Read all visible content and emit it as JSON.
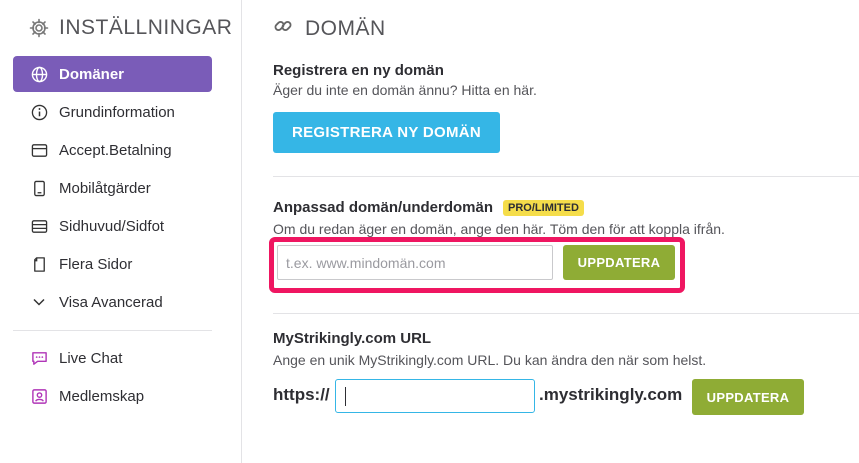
{
  "sidebar": {
    "title": "INSTÄLLNINGAR",
    "icon": "gear-icon",
    "items": [
      {
        "label": "Domäner",
        "icon": "globe-icon",
        "active": true
      },
      {
        "label": "Grundinformation",
        "icon": "info-icon"
      },
      {
        "label": "Accept.Betalning",
        "icon": "card-icon"
      },
      {
        "label": "Mobilåtgärder",
        "icon": "mobile-icon"
      },
      {
        "label": "Sidhuvud/Sidfot",
        "icon": "layout-icon"
      },
      {
        "label": "Flera Sidor",
        "icon": "pages-icon"
      },
      {
        "label": "Visa Avancerad",
        "icon": "chevron-down-icon"
      }
    ],
    "secondary_items": [
      {
        "label": "Live Chat",
        "icon": "chat-icon"
      },
      {
        "label": "Medlemskap",
        "icon": "member-icon"
      }
    ]
  },
  "main": {
    "title": "DOMÄN",
    "icon": "link-icon",
    "register": {
      "title": "Registrera en ny domän",
      "desc": "Äger du inte en domän ännu? Hitta en här.",
      "button": "REGISTRERA NY DOMÄN"
    },
    "custom": {
      "title": "Anpassad domän/underdomän",
      "badge": "PRO/LIMITED",
      "desc": "Om du redan äger en domän, ange den här. Töm den för att koppla ifrån.",
      "placeholder": "t.ex. www.mindomän.com",
      "button": "UPPDATERA"
    },
    "url": {
      "title": "MyStrikingly.com URL",
      "desc": "Ange en unik MyStrikingly.com URL. Du kan ändra den när som helst.",
      "prefix": "https://",
      "value": "",
      "suffix": ".mystrikingly.com",
      "button": "UPPDATERA"
    }
  },
  "colors": {
    "accent": "#7a5cb8",
    "blue": "#35b6e6",
    "green": "#8fac35",
    "highlight": "#ef1661",
    "badge": "#f5dd4a"
  }
}
